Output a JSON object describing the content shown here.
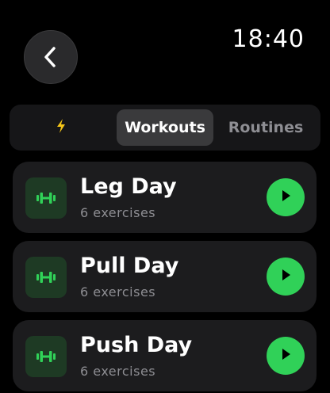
{
  "status": {
    "time": "18:40"
  },
  "nav": {
    "back_icon": "chevron-left-icon"
  },
  "segments": [
    {
      "id": "quick",
      "icon": "lightning-bolt-icon",
      "selected": false
    },
    {
      "id": "workouts",
      "label": "Workouts",
      "selected": true
    },
    {
      "id": "routines",
      "label": "Routines",
      "selected": false
    }
  ],
  "workouts": [
    {
      "title": "Leg Day",
      "subtitle": "6 exercises",
      "icon": "dumbbell-icon",
      "action_icon": "play-icon"
    },
    {
      "title": "Pull Day",
      "subtitle": "6 exercises",
      "icon": "dumbbell-icon",
      "action_icon": "play-icon"
    },
    {
      "title": "Push Day",
      "subtitle": "6 exercises",
      "icon": "dumbbell-icon",
      "action_icon": "play-icon"
    }
  ],
  "colors": {
    "accent": "#30d158",
    "icon_tile": "#1e3a24",
    "bolt": "#f5c518",
    "card": "#1c1c1e",
    "segment_selected": "#3a3a3c",
    "secondary_text": "#8e8e93"
  }
}
